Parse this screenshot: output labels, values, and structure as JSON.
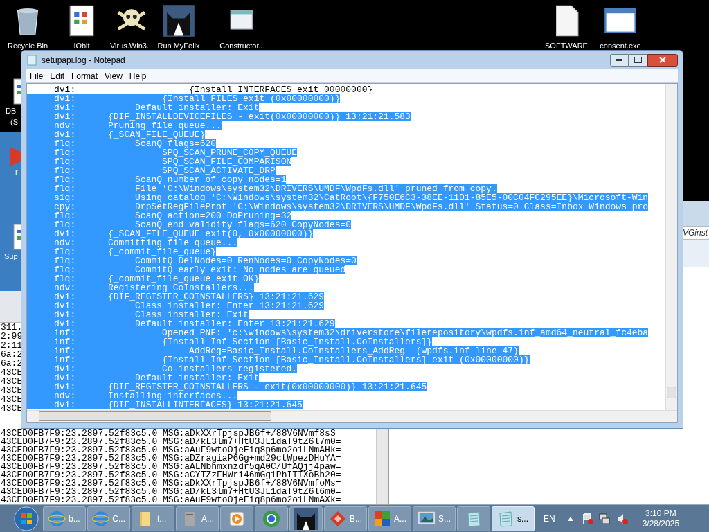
{
  "desktop": {
    "icons": [
      {
        "label": "Recycle Bin",
        "kind": "bin"
      },
      {
        "label": "IObit",
        "kind": "doc"
      },
      {
        "label": "Virus.Win3...",
        "kind": "skull"
      },
      {
        "label": "Run MyFelix",
        "kind": "cat"
      },
      {
        "label": "Constructor...",
        "kind": "window"
      },
      {
        "label": "SOFTWARE",
        "kind": "file"
      },
      {
        "label": "consent.exe",
        "kind": "app"
      }
    ],
    "side_icons": [
      {
        "label_lines": [
          "DB",
          "(S"
        ],
        "kind": "doc"
      },
      {
        "label_lines": [
          "r"
        ],
        "kind": "red"
      },
      {
        "label_lines": [
          "Sup"
        ],
        "kind": "doc"
      }
    ]
  },
  "log_window": {
    "fragments": [
      "311.",
      "2:99",
      "2:11",
      "6a:2",
      "6a:2",
      "43CE",
      "43CE",
      "43CE",
      "43CE",
      "43CE"
    ],
    "lines": [
      "43CED0FB7F9:23.2897.52f83c5.0 MSG:aDkXXrTpjspJB6f+/88V6NVmf8sS=",
      "43CED0FB7F9:23.2897.52f83c5.0 MSG:aD/kL3lm7+HtU3JL1daT9tZ6l7m0=",
      "43CED0FB7F9:23.2897.52f83c5.0 MSG:aAuF9wtoOjeEiq8p6mo2o1LNmAHk=",
      "43CED0FB7F9:23.2897.52f83c5.0 MSG:aDZragiaP6Gg+md29ctWpezDHuYA=",
      "43CED0FB7F9:23.2897.52f83c5.0 MSG:aALNbhmxnzdr5qA0C/UfAQjj4paw=",
      "43CED0FB7F9:23.2897.52f83c5.0 MSG:aCYTZzFHWri46mGg1PhITIXoBb20=",
      "43CED0FB7F9:23.2897.52f83c5.0 MSG:aDkXXrTpjspJB6f+/88V6NVmfoMs=",
      "43CED0FB7F9:23.2897.52f83c5.0 MSG:aD/kL3lm7+HtU3JL1daT9tZ6l6m0=",
      "43CED0FB7F9:23.2897.52f83c5.0 MSG:aAuF9wtoOjeEiq8p6mo2o1LNmAXk="
    ]
  },
  "right_window": {
    "title": "VGinst"
  },
  "notepad": {
    "title": "setupapi.log - Notepad",
    "menu": [
      "File",
      "Edit",
      "Format",
      "View",
      "Help"
    ],
    "lines": [
      {
        "text": "     dvi:                     {Install INTERFACES exit 00000000}",
        "selected": false
      },
      {
        "text": "     dvi:                {Install FILES exit (0x00000000)}",
        "selected": true
      },
      {
        "text": "     dvi:           Default installer: Exit",
        "selected": true
      },
      {
        "text": "     dvi:      {DIF_INSTALLDEVICEFILES - exit(0x00000000)} 13:21:21.583",
        "selected": true
      },
      {
        "text": "     ndv:      Pruning file queue...",
        "selected": true
      },
      {
        "text": "     dvi:      {_SCAN_FILE_QUEUE}",
        "selected": true
      },
      {
        "text": "     flq:           ScanQ flags=620",
        "selected": true
      },
      {
        "text": "     flq:                SPQ_SCAN_PRUNE_COPY_QUEUE",
        "selected": true
      },
      {
        "text": "     flq:                SPQ_SCAN_FILE_COMPARISON",
        "selected": true
      },
      {
        "text": "     flq:                SPQ_SCAN_ACTIVATE_DRP",
        "selected": true
      },
      {
        "text": "     flq:           ScanQ number of copy nodes=1",
        "selected": true
      },
      {
        "text": "     flq:           File 'C:\\Windows\\system32\\DRIVERS\\UMDF\\WpdFs.dll' pruned from copy.",
        "selected": true
      },
      {
        "text": "     sig:           Using catalog 'C:\\Windows\\system32\\CatRoot\\{F750E6C3-38EE-11D1-85E5-00C04FC295EE}\\Microsoft-Win",
        "selected": true
      },
      {
        "text": "     cpy:           DrpSetRegFileProt 'C:\\Windows\\system32\\DRIVERS\\UMDF\\WpdFs.dll' Status=0 Class=Inbox Windows pro",
        "selected": true
      },
      {
        "text": "     flq:           ScanQ action=200 DoPruning=32",
        "selected": true
      },
      {
        "text": "     flq:           ScanQ end validity flags=620 CopyNodes=0",
        "selected": true
      },
      {
        "text": "     dvi:      {_SCAN_FILE_QUEUE exit(0, 0x00000000)}",
        "selected": true
      },
      {
        "text": "     ndv:      Committing file queue...",
        "selected": true
      },
      {
        "text": "     flq:      {_commit_file_queue}",
        "selected": true
      },
      {
        "text": "     flq:           CommitQ DelNodes=0 RenNodes=0 CopyNodes=0",
        "selected": true
      },
      {
        "text": "     flq:           CommitQ early exit: No nodes are queued",
        "selected": true
      },
      {
        "text": "     flq:      {_commit_file_queue exit OK}",
        "selected": true
      },
      {
        "text": "     ndv:      Registering CoInstallers...",
        "selected": true
      },
      {
        "text": "     dvi:      {DIF_REGISTER_COINSTALLERS} 13:21:21.629",
        "selected": true
      },
      {
        "text": "     dvi:           Class installer: Enter 13:21:21.629",
        "selected": true
      },
      {
        "text": "     dvi:           Class installer: Exit",
        "selected": true
      },
      {
        "text": "     dvi:           Default installer: Enter 13:21:21.629",
        "selected": true
      },
      {
        "text": "     inf:                Opened PNF: 'c:\\windows\\system32\\driverstore\\filerepository\\wpdfs.inf_amd64_neutral_fc4eba",
        "selected": true
      },
      {
        "text": "     inf:                {Install Inf Section [Basic_Install.CoInstallers]}",
        "selected": true
      },
      {
        "text": "     inf:                     AddReg=Basic_Install.CoInstallers_AddReg  (wpdfs.inf line 47)",
        "selected": true
      },
      {
        "text": "     inf:                {Install Inf Section [Basic_Install.CoInstallers] exit (0x00000000)}",
        "selected": true
      },
      {
        "text": "     dvi:                Co-installers registered.",
        "selected": true
      },
      {
        "text": "     dvi:           Default installer: Exit",
        "selected": true
      },
      {
        "text": "     dvi:      {DIF_REGISTER_COINSTALLERS - exit(0x00000000)} 13:21:21.645",
        "selected": true
      },
      {
        "text": "     ndv:      Installing interfaces...",
        "selected": true
      },
      {
        "text": "     dvi:      {DIF_INSTALLINTERFACES} 13:21:21.645",
        "selected": true
      }
    ]
  },
  "taskbar": {
    "items": [
      {
        "label": "b...",
        "kind": "ie",
        "selected": false
      },
      {
        "label": "C...",
        "kind": "ie",
        "selected": false
      },
      {
        "label": "t...",
        "kind": "folder",
        "selected": false
      },
      {
        "label": "A...",
        "kind": "drive",
        "selected": false
      },
      {
        "kind": "media",
        "selected": false
      },
      {
        "kind": "globe",
        "selected": false
      },
      {
        "kind": "cat",
        "selected": false
      },
      {
        "label": "B...",
        "kind": "red",
        "selected": false
      },
      {
        "label": "A...",
        "kind": "tiles",
        "selected": false
      },
      {
        "label": "S...",
        "kind": "screen",
        "selected": false
      },
      {
        "kind": "notepad",
        "selected": false
      },
      {
        "label": "s...",
        "kind": "notepad",
        "selected": true
      }
    ],
    "language": "EN",
    "time": "3:10 PM",
    "date": "3/28/2025"
  }
}
